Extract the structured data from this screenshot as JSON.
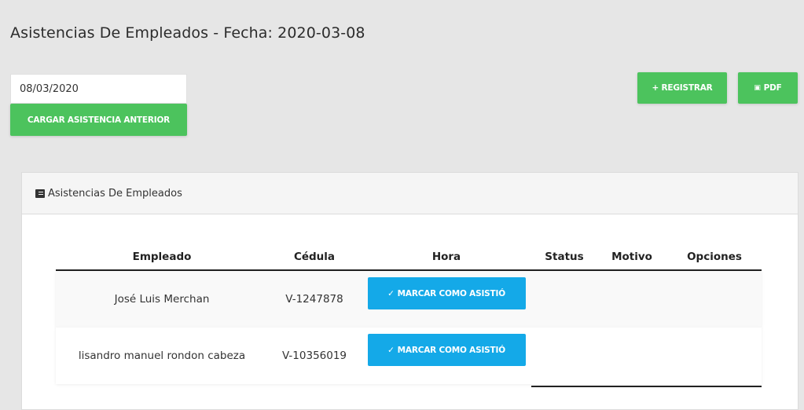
{
  "header": {
    "title": "Asistencias De Empleados - Fecha: 2020-03-08"
  },
  "controls": {
    "date_value": "08/03/2020",
    "load_previous_label": "CARGAR ASISTENCIA ANTERIOR",
    "register_label": "+ REGISTRAR",
    "pdf_label": "PDF"
  },
  "card": {
    "title": "Asistencias De Empleados"
  },
  "table": {
    "columns": [
      "Empleado",
      "Cédula",
      "Hora",
      "Status",
      "Motivo",
      "Opciones"
    ],
    "rows": [
      {
        "empleado": "José Luis Merchan",
        "cedula": "V-1247878",
        "action_label": "MARCAR COMO ASISTIÓ",
        "status": "",
        "motivo": ""
      },
      {
        "empleado": "lisandro manuel rondon cabeza",
        "cedula": "V-10356019",
        "action_label": "MARCAR COMO ASISTIÓ",
        "status": "",
        "motivo": ""
      }
    ]
  },
  "colors": {
    "green": "#4cc35d",
    "blue": "#14a9e8",
    "background": "#e6e6e6"
  },
  "icons": {
    "pdf": "file-pdf-icon",
    "card": "list-icon",
    "check": "check-icon"
  }
}
